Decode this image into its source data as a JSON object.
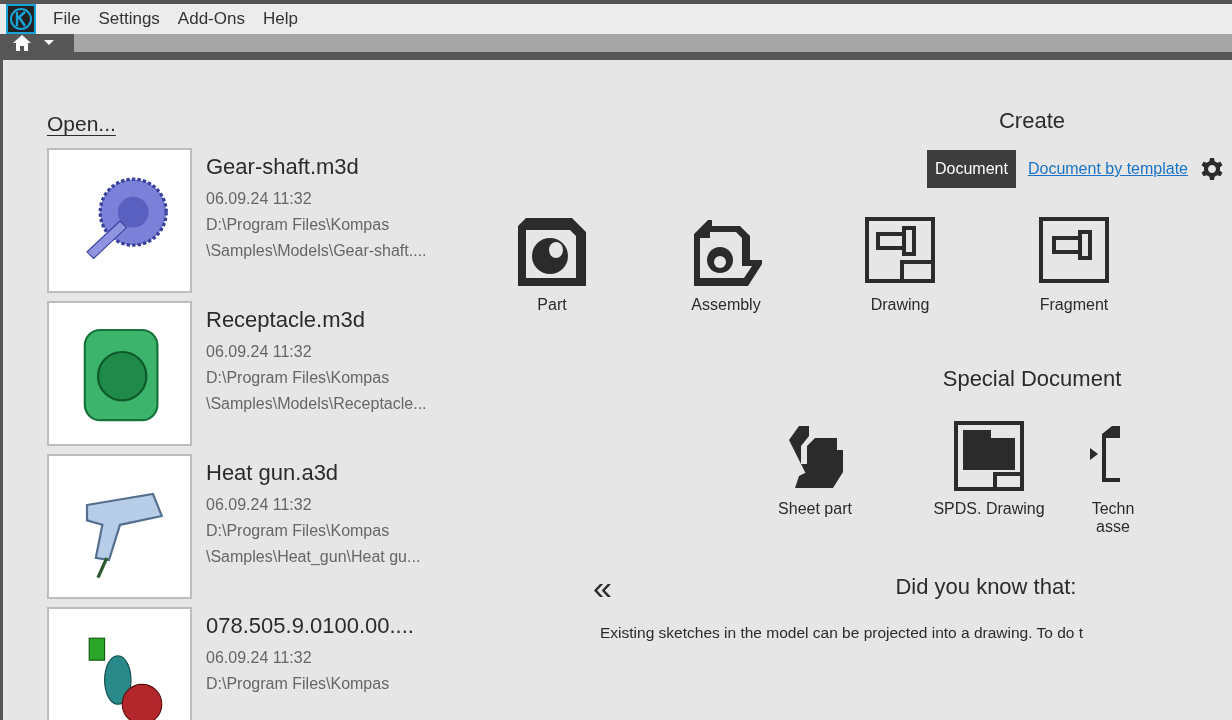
{
  "menu": [
    "File",
    "Settings",
    "Add-Ons",
    "Help"
  ],
  "open_title": "Open...",
  "recent_files": [
    {
      "kind": "gear",
      "name": "Gear-shaft.m3d",
      "date": "06.09.24 11:32",
      "path_lines": [
        "D:\\Program Files\\Kompas",
        "\\Samples\\Models\\Gear-shaft...."
      ]
    },
    {
      "kind": "receptacle",
      "name": "Receptacle.m3d",
      "date": "06.09.24 11:32",
      "path_lines": [
        "D:\\Program Files\\Kompas",
        "\\Samples\\Models\\Receptacle..."
      ]
    },
    {
      "kind": "heatgun",
      "name": "Heat gun.a3d",
      "date": "06.09.24 11:32",
      "path_lines": [
        "D:\\Program Files\\Kompas",
        "\\Samples\\Heat_gun\\Heat gu..."
      ]
    },
    {
      "kind": "assembly",
      "name": "078.505.9.0100.00....",
      "date": "06.09.24 11:32",
      "path_lines": [
        "D:\\Program Files\\Kompas"
      ]
    }
  ],
  "create": {
    "title": "Create",
    "modes": [
      {
        "label": "Document",
        "selected": true
      },
      {
        "label": "Document by template",
        "selected": false
      }
    ],
    "documents": [
      {
        "kind": "part",
        "label": "Part"
      },
      {
        "kind": "assembly",
        "label": "Assembly"
      },
      {
        "kind": "drawing",
        "label": "Drawing"
      },
      {
        "kind": "fragment",
        "label": "Fragment"
      }
    ]
  },
  "special": {
    "title": "Special Document",
    "documents": [
      {
        "kind": "sheet",
        "label": "Sheet part"
      },
      {
        "kind": "spds",
        "label": "SPDS. Drawing"
      },
      {
        "kind": "tech",
        "label": "Techn asse"
      }
    ]
  },
  "tips": {
    "title": "Did you know that:",
    "back": "«",
    "text": "Existing sketches in the model can be projected into a drawing. To do t"
  }
}
